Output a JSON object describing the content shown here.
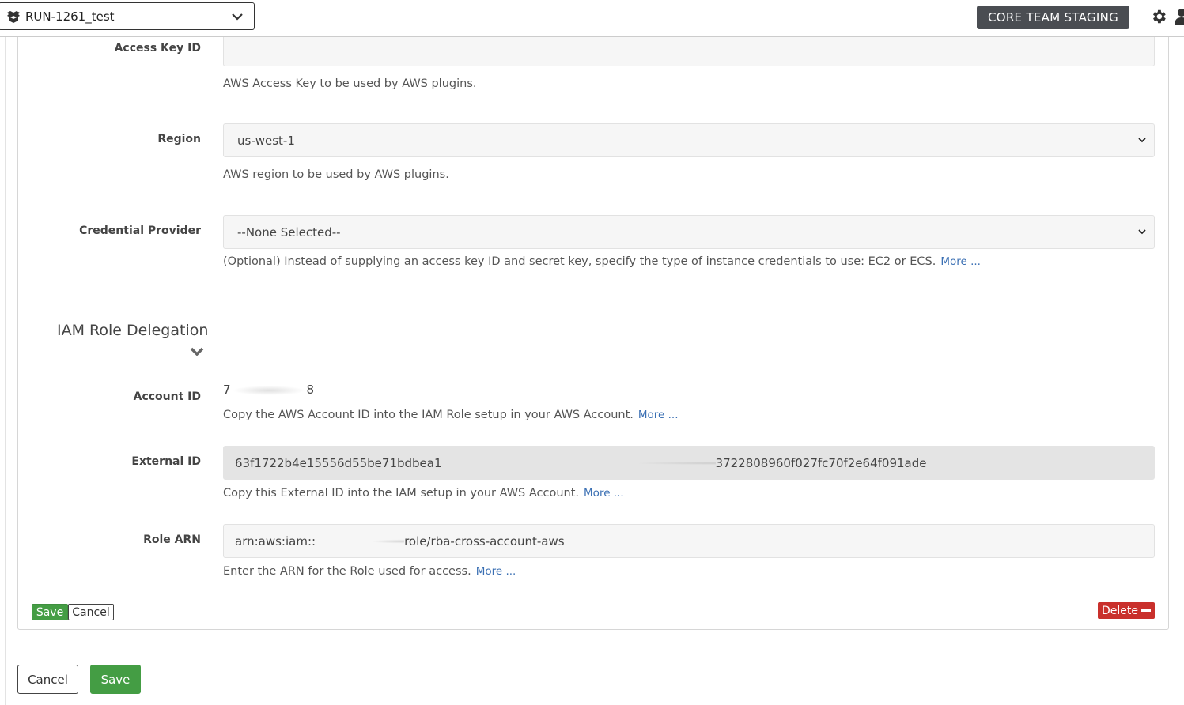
{
  "topbar": {
    "project_name": "RUN-1261_test",
    "environment_badge": "CORE TEAM STAGING"
  },
  "aws": {
    "access_key_label": "Access Key ID",
    "access_key_value": "",
    "access_key_help": "AWS Access Key to be used by AWS plugins.",
    "region_label": "Region",
    "region_value": "us-west-1",
    "region_help": "AWS region to be used by AWS plugins.",
    "credential_label": "Credential Provider",
    "credential_value": "--None Selected--",
    "credential_help": "(Optional) Instead of supplying an access key ID and secret key, specify the type of instance credentials to use: EC2 or ECS.",
    "more_label": "More ..."
  },
  "iam": {
    "section_title": "IAM Role Delegation",
    "account_label": "Account ID",
    "account_prefix": "7",
    "account_suffix": "8",
    "account_help": "Copy the AWS Account ID into the IAM Role setup in your AWS Account.",
    "external_label": "External ID",
    "external_prefix": "63f1722b4e15556d55be71bdbea1",
    "external_suffix": "3722808960f027fc70f2e64f091ade",
    "external_help": "Copy this External ID into the IAM setup in your AWS Account.",
    "role_label": "Role ARN",
    "role_prefix": "arn:aws:iam::",
    "role_suffix": "role/rba-cross-account-aws",
    "role_help": "Enter the ARN for the Role used for access."
  },
  "actions": {
    "save_small": "Save",
    "cancel_small": "Cancel",
    "delete": "Delete",
    "cancel_large": "Cancel",
    "save_large": "Save"
  },
  "colors": {
    "save_green": "#449d44",
    "delete_red": "#c9302c",
    "badge_dark": "#4a4d52",
    "link_blue": "#3a6fb3"
  },
  "icons": {
    "project": "box-icon",
    "dropdown": "chevron-down-icon",
    "settings": "gear-icon",
    "user": "user-icon"
  }
}
